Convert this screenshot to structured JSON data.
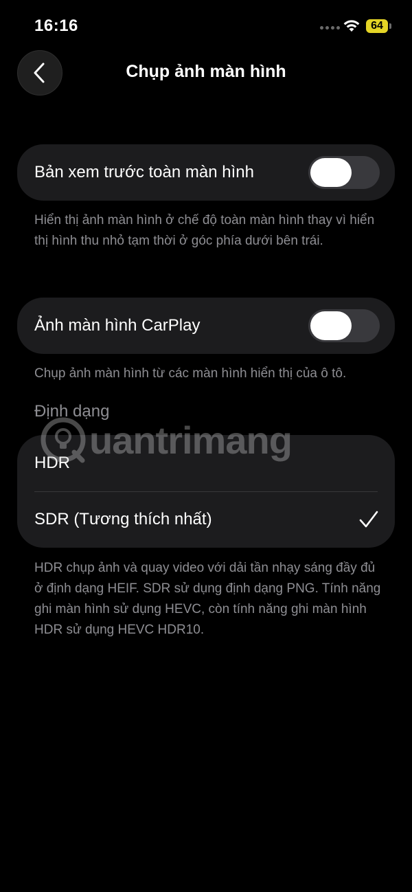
{
  "status_bar": {
    "time": "16:16",
    "battery": "64"
  },
  "nav": {
    "title": "Chụp ảnh màn hình"
  },
  "fullscreen_preview": {
    "label": "Bản xem trước toàn màn hình",
    "enabled": false,
    "footnote": "Hiển thị ảnh màn hình ở chế độ toàn màn hình thay vì hiển thị hình thu nhỏ tạm thời ở góc phía dưới bên trái."
  },
  "carplay": {
    "label": "Ảnh màn hình CarPlay",
    "enabled": false,
    "footnote": "Chụp ảnh màn hình từ các màn hình hiển thị của ô tô."
  },
  "format": {
    "header": "Định dạng",
    "options": [
      {
        "label": "HDR",
        "selected": false
      },
      {
        "label": "SDR (Tương thích nhất)",
        "selected": true
      }
    ],
    "footnote": "HDR chụp ảnh và quay video với dải tần nhạy sáng đầy đủ ở định dạng HEIF. SDR sử dụng định dạng PNG. Tính năng ghi màn hình sử dụng HEVC, còn tính năng ghi màn hình HDR sử dụng HEVC HDR10."
  },
  "watermark": {
    "text": "uantrimang"
  },
  "colors": {
    "background": "#000000",
    "card": "#1c1c1e",
    "secondary_text": "#8e8e93",
    "toggle_off": "#39393d",
    "battery": "#e4d426"
  }
}
